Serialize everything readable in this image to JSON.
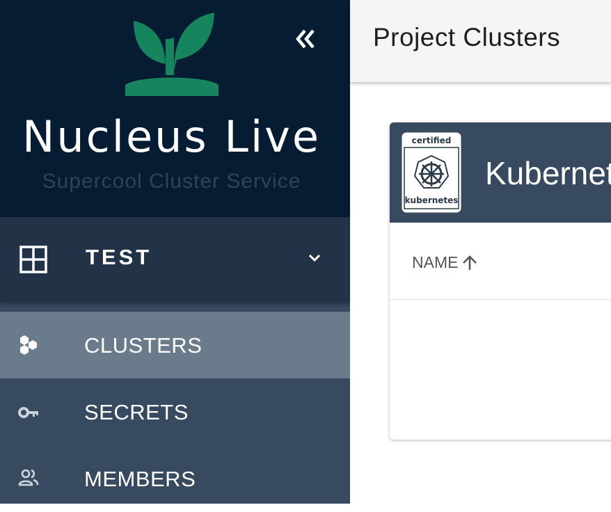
{
  "brand": {
    "title": "Nucleus Live",
    "subtitle": "Supercool Cluster Service",
    "logo_icon": "sprout-icon"
  },
  "project": {
    "name": "TEST",
    "icon": "grid-icon"
  },
  "nav": {
    "items": [
      {
        "label": "CLUSTERS",
        "icon": "hexagons-icon",
        "active": true
      },
      {
        "label": "SECRETS",
        "icon": "key-icon",
        "active": false
      },
      {
        "label": "MEMBERS",
        "icon": "people-icon",
        "active": false
      }
    ]
  },
  "header": {
    "title": "Project Clusters"
  },
  "card": {
    "title": "Kubernetes",
    "badge_top": "certified",
    "badge_bottom": "kubernetes",
    "column_name": "NAME"
  },
  "colors": {
    "sidebar_dark": "#061c32",
    "sidebar": "#384a5f",
    "project_row": "#223348",
    "active_item": "#6a7b8c",
    "brand_green": "#16845d"
  }
}
